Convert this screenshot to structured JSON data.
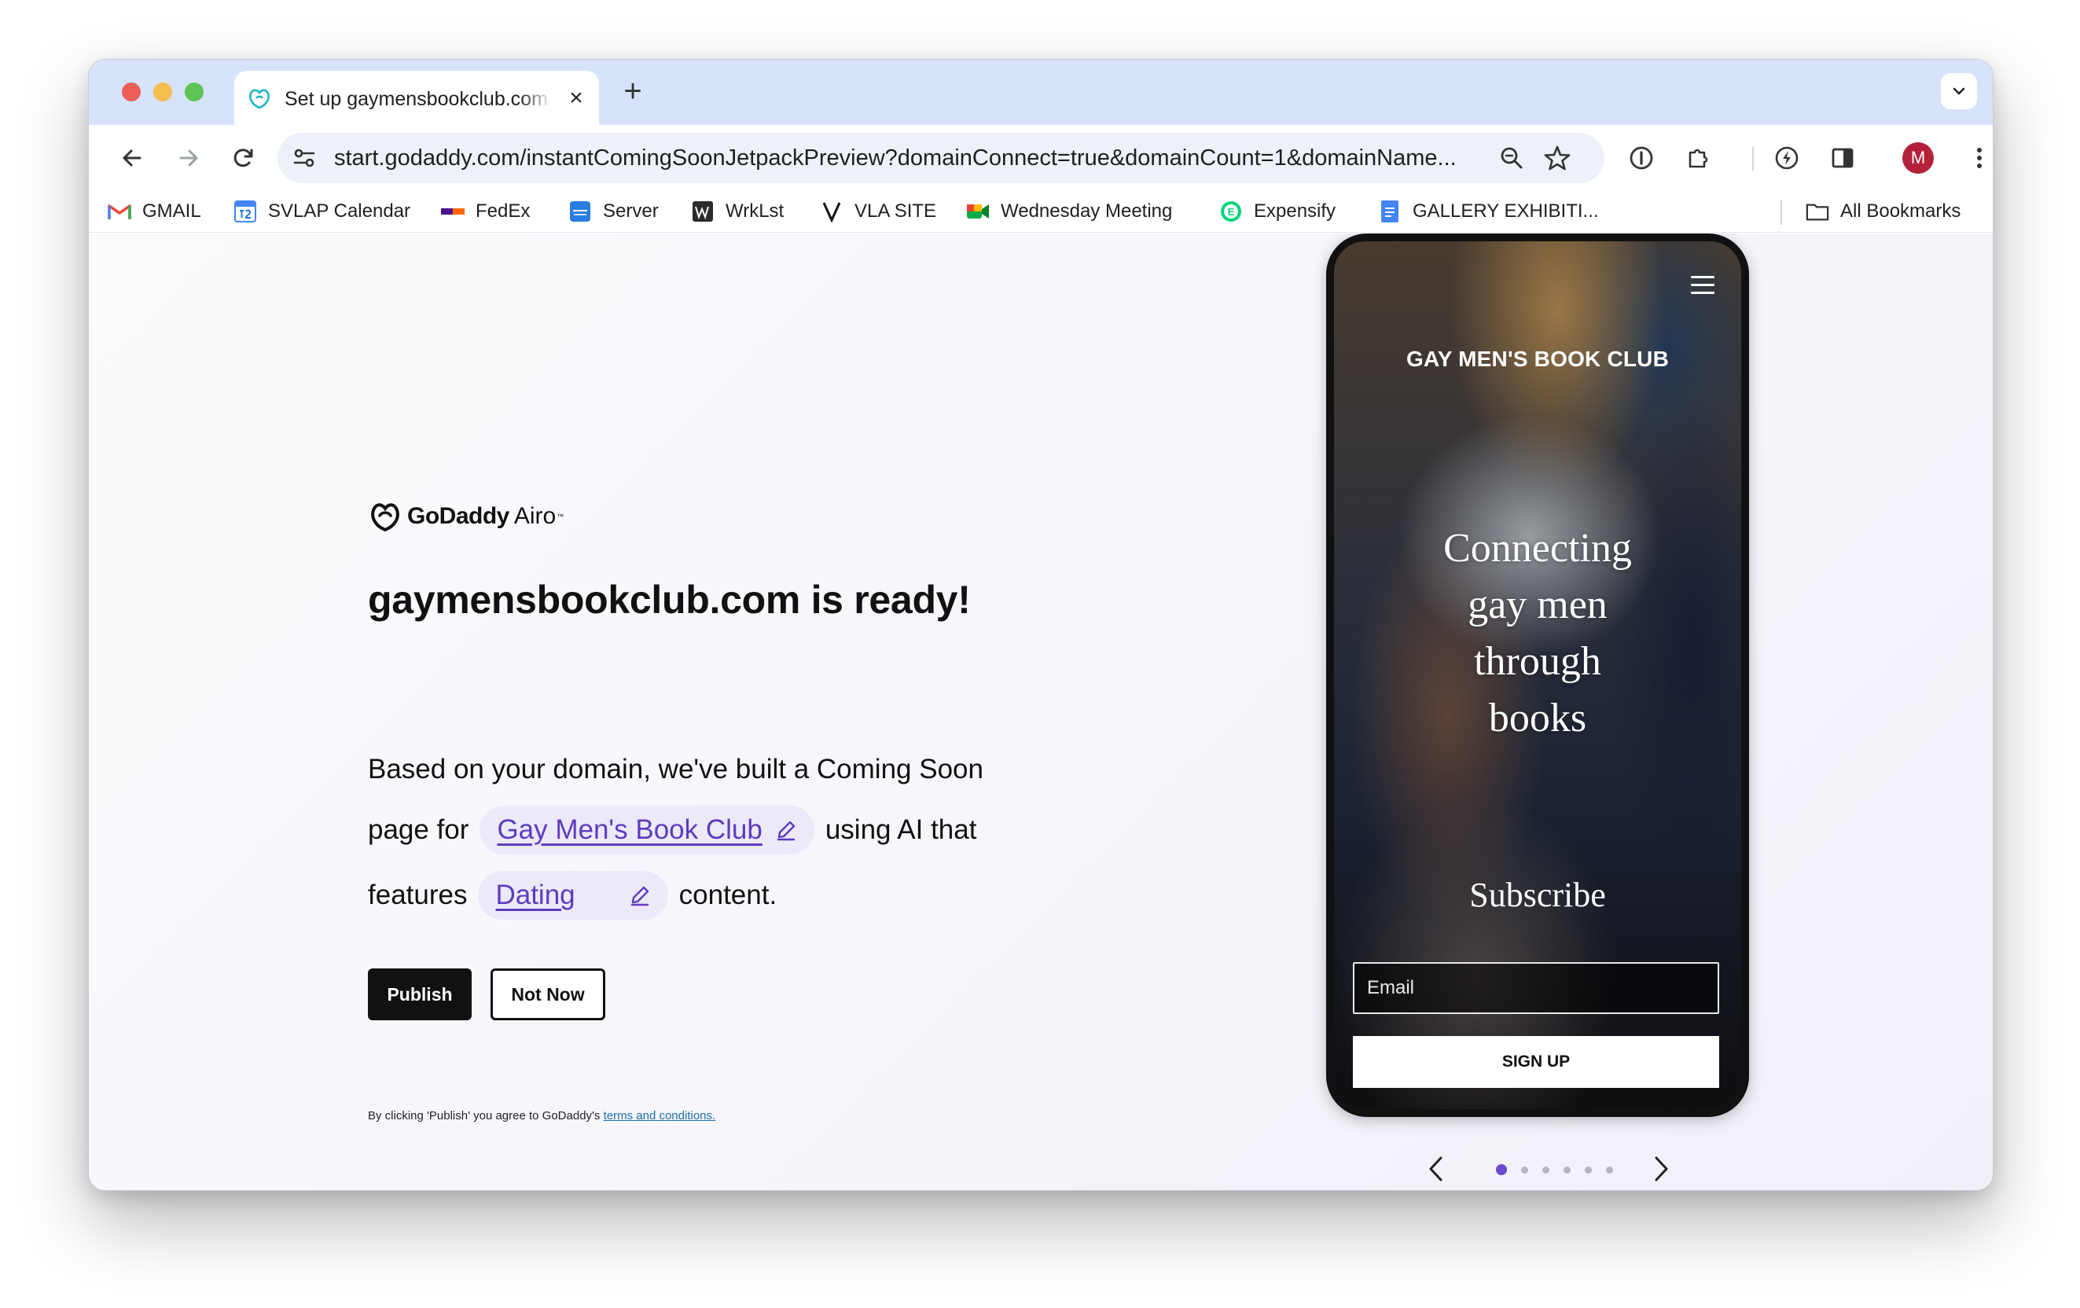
{
  "browser": {
    "tab": {
      "title": "Set up gaymensbookclub.com"
    },
    "url": "start.godaddy.com/instantComingSoonJetpackPreview?domainConnect=true&domainCount=1&domainName...",
    "profile_initial": "M",
    "bookmarks": [
      {
        "label": "GMAIL",
        "icon": "gmail-icon"
      },
      {
        "label": "SVLAP Calendar",
        "icon": "calendar-icon"
      },
      {
        "label": "FedEx",
        "icon": "fedex-icon"
      },
      {
        "label": "Server",
        "icon": "dsm-icon"
      },
      {
        "label": "WrkLst",
        "icon": "wrklst-icon"
      },
      {
        "label": "VLA SITE",
        "icon": "v-icon"
      },
      {
        "label": "Wednesday Meeting",
        "icon": "meet-icon"
      },
      {
        "label": "Expensify",
        "icon": "expensify-icon"
      },
      {
        "label": "GALLERY EXHIBITI...",
        "icon": "docs-icon"
      }
    ],
    "all_bookmarks": "All Bookmarks"
  },
  "page": {
    "logo": {
      "word": "GoDaddy",
      "product": "Airo",
      "tm": "™"
    },
    "headline": "gaymensbookclub.com is ready!",
    "line1": "Based on your domain, we've built a Coming Soon",
    "line2_prefix": "page for",
    "business_name": "Gay Men's Book Club",
    "line2_suffix": "using AI that",
    "line3_prefix": "features",
    "category": "Dating",
    "line3_suffix": "content.",
    "publish_label": "Publish",
    "not_now_label": "Not Now",
    "legal_text": "By clicking 'Publish' you agree to GoDaddy's",
    "legal_link": "terms and conditions."
  },
  "preview": {
    "site_title": "GAY MEN'S BOOK CLUB",
    "tagline_lines": [
      "Connecting",
      "gay men",
      "through",
      "books"
    ],
    "subscribe_heading": "Subscribe",
    "email_placeholder": "Email",
    "signup_label": "SIGN UP",
    "carousel": {
      "total": 6,
      "active": 1
    }
  },
  "colors": {
    "accent": "#6a4bd0",
    "chip_bg": "#ece9f9",
    "tab_strip": "#d6e3fb",
    "profile": "#b3213b"
  }
}
